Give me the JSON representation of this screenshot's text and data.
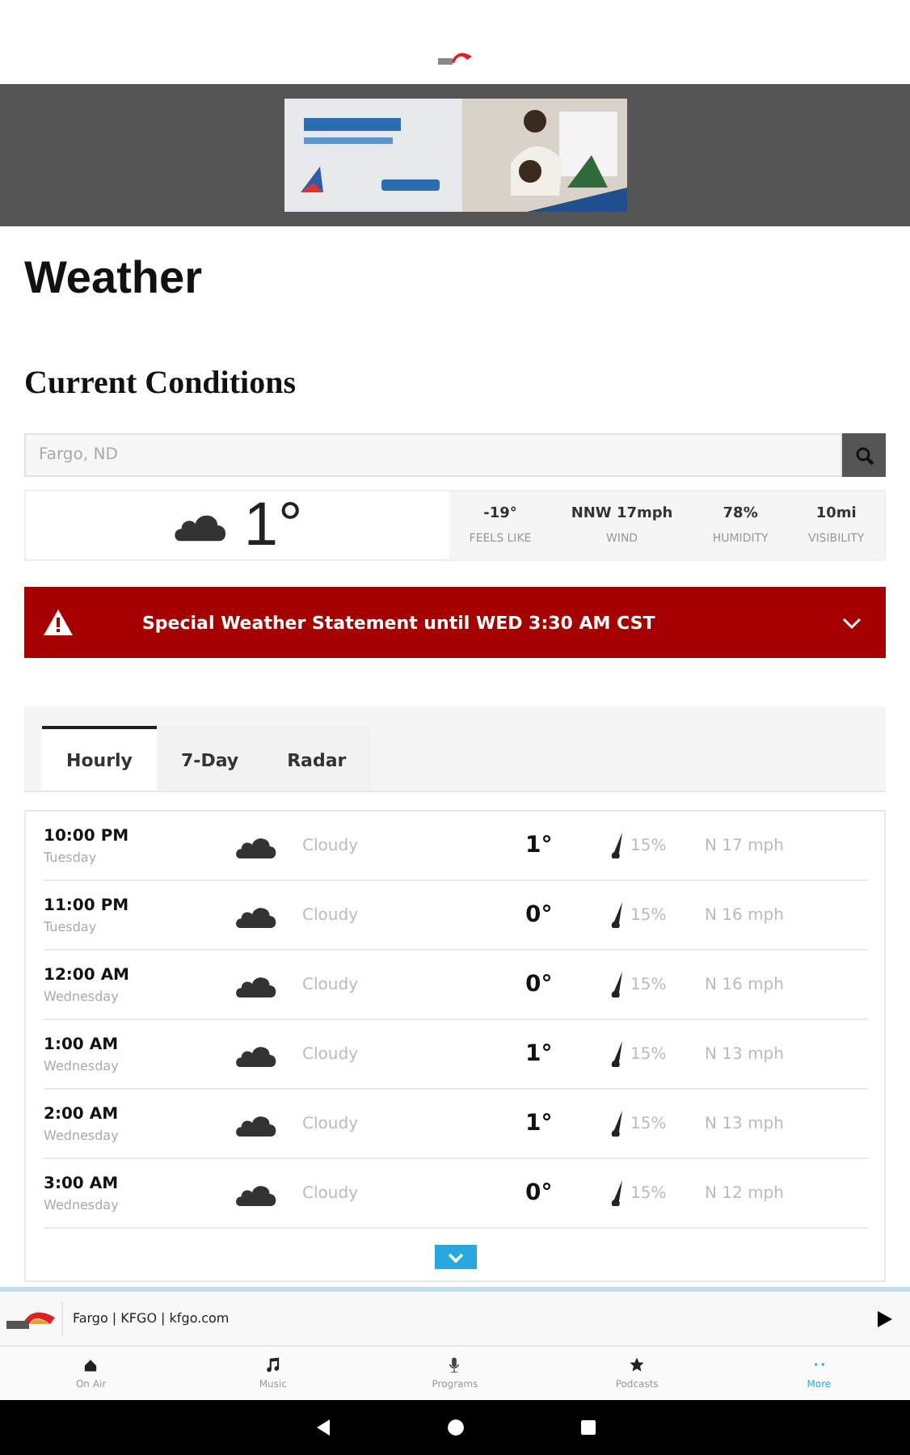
{
  "title": "Weather",
  "section_title": "Current Conditions",
  "search": {
    "placeholder": "Fargo, ND"
  },
  "current": {
    "temperature": "1°",
    "stats": [
      {
        "value": "-19°",
        "label": "FEELS LIKE"
      },
      {
        "value": "NNW 17mph",
        "label": "WIND"
      },
      {
        "value": "78%",
        "label": "HUMIDITY"
      },
      {
        "value": "10mi",
        "label": "VISIBILITY"
      }
    ]
  },
  "alert": {
    "text": "Special Weather Statement until WED 3:30 AM CST"
  },
  "tabs": [
    {
      "label": "Hourly",
      "selected": true
    },
    {
      "label": "7-Day",
      "selected": false
    },
    {
      "label": "Radar",
      "selected": false
    }
  ],
  "hourly": [
    {
      "time": "10:00 PM",
      "day": "Tuesday",
      "condition": "Cloudy",
      "temp": "1°",
      "precip": "15%",
      "wind": "N 17 mph"
    },
    {
      "time": "11:00 PM",
      "day": "Tuesday",
      "condition": "Cloudy",
      "temp": "0°",
      "precip": "15%",
      "wind": "N 16 mph"
    },
    {
      "time": "12:00 AM",
      "day": "Wednesday",
      "condition": "Cloudy",
      "temp": "0°",
      "precip": "15%",
      "wind": "N 16 mph"
    },
    {
      "time": "1:00 AM",
      "day": "Wednesday",
      "condition": "Cloudy",
      "temp": "1°",
      "precip": "15%",
      "wind": "N 13 mph"
    },
    {
      "time": "2:00 AM",
      "day": "Wednesday",
      "condition": "Cloudy",
      "temp": "1°",
      "precip": "15%",
      "wind": "N 13 mph"
    },
    {
      "time": "3:00 AM",
      "day": "Wednesday",
      "condition": "Cloudy",
      "temp": "0°",
      "precip": "15%",
      "wind": "N 12 mph"
    }
  ],
  "player": {
    "station": "Fargo | KFGO | kfgo.com"
  },
  "nav": [
    {
      "label": "On Air",
      "selected": false
    },
    {
      "label": "Music",
      "selected": false
    },
    {
      "label": "Programs",
      "selected": false
    },
    {
      "label": "Podcasts",
      "selected": false
    },
    {
      "label": "More",
      "selected": true
    }
  ]
}
